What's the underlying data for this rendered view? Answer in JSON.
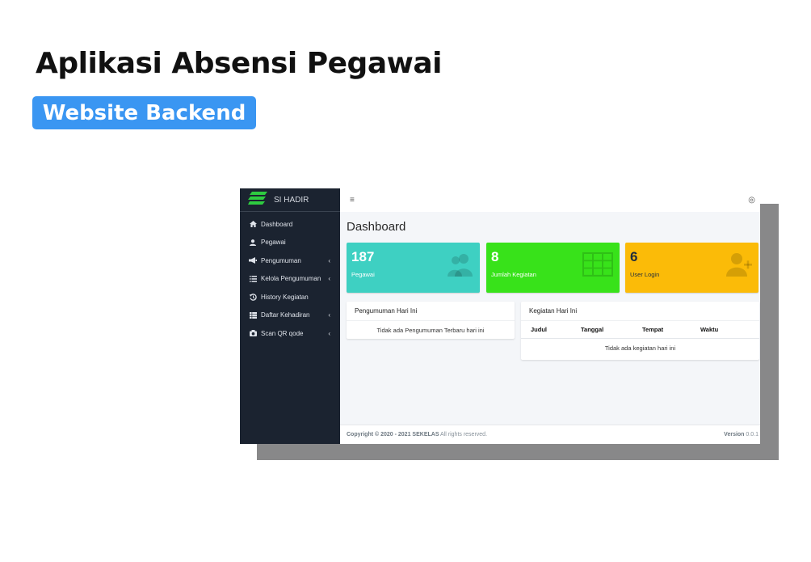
{
  "hero": {
    "title": "Aplikasi Absensi Pegawai",
    "badge": "Website Backend"
  },
  "app": {
    "brand": "SI HADIR",
    "sidebar": {
      "items": [
        {
          "label": "Dashboard",
          "icon": "home-icon",
          "chevron": false
        },
        {
          "label": "Pegawai",
          "icon": "user-icon",
          "chevron": false
        },
        {
          "label": "Pengumuman",
          "icon": "megaphone-icon",
          "chevron": true
        },
        {
          "label": "Kelola Pengumuman",
          "icon": "list-icon",
          "chevron": true
        },
        {
          "label": "History Kegiatan",
          "icon": "history-icon",
          "chevron": false
        },
        {
          "label": "Daftar Kehadiran",
          "icon": "table-icon",
          "chevron": true
        },
        {
          "label": "Scan QR qode",
          "icon": "camera-icon",
          "chevron": true
        }
      ],
      "chevron_glyph": "‹"
    },
    "topbar": {
      "menu_glyph": "≡",
      "user_glyph": "◎"
    },
    "page_title": "Dashboard",
    "stats": [
      {
        "value": "187",
        "label": "Pegawai",
        "icon": "users-icon",
        "color": "#3ed0c2"
      },
      {
        "value": "8",
        "label": "Jumlah Kegiatan",
        "icon": "grid-icon",
        "color": "#38e21a"
      },
      {
        "value": "6",
        "label": "User Login",
        "icon": "user-plus-icon",
        "color": "#fbbb08"
      }
    ],
    "announcements": {
      "title": "Pengumuman Hari Ini",
      "empty": "Tidak ada Pengumuman Terbaru hari ini"
    },
    "activities": {
      "title": "Kegiatan Hari Ini",
      "columns": [
        "Judul",
        "Tanggal",
        "Tempat",
        "Waktu"
      ],
      "empty": "Tidak ada kegiatan hari ini"
    },
    "footer": {
      "copyright_prefix": "Copyright © 2020 - 2021",
      "company": "SEKELAS",
      "rights": "All rights reserved.",
      "version_label": "Version",
      "version": "0.0.1"
    }
  },
  "colors": {
    "badge": "#3a96f2",
    "sidebar": "#1b2330",
    "brand_logo": "#2ecc40"
  }
}
